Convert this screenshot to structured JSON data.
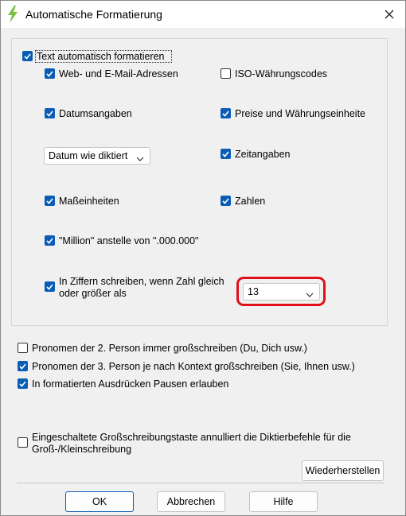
{
  "window": {
    "title": "Automatische Formatierung",
    "app_icon": "lightning-icon",
    "close_icon": "close-icon"
  },
  "main_checkbox": {
    "label": "Text automatisch formatieren",
    "checked": true
  },
  "options": {
    "web_email": {
      "label": "Web- und E-Mail-Adressen",
      "checked": true
    },
    "iso_currency": {
      "label": "ISO-Währungscodes",
      "checked": false
    },
    "dates": {
      "label": "Datumsangaben",
      "checked": true
    },
    "prices": {
      "label": "Preise und Währungseinheite",
      "checked": true
    },
    "date_format_select": {
      "value": "Datum wie diktiert"
    },
    "times": {
      "label": "Zeitangaben",
      "checked": true
    },
    "units": {
      "label": "Maßeinheiten",
      "checked": true
    },
    "numbers": {
      "label": "Zahlen",
      "checked": true
    },
    "million": {
      "label": "\"Million\" anstelle von \".000.000\"",
      "checked": true
    },
    "digits": {
      "line1": "In Ziffern schreiben, wenn Zahl gleich",
      "line2": "oder größer als",
      "checked": true
    },
    "digits_select": {
      "value": "13"
    }
  },
  "lower": {
    "pronoun2": {
      "label": "Pronomen der 2. Person immer großschreiben (Du, Dich usw.)",
      "checked": false
    },
    "pronoun3": {
      "label": "Pronomen der 3. Person je nach Kontext großschreiben (Sie, Ihnen usw.)",
      "checked": true
    },
    "pauses": {
      "label": "In formatierten Ausdrücken Pausen erlauben",
      "checked": true
    },
    "capslock": {
      "line1": "Eingeschaltete Großschreibungstaste annulliert die Diktierbefehle für die",
      "line2": "Groß-/Kleinschreibung",
      "checked": false
    }
  },
  "buttons": {
    "restore": "Wiederherstellen",
    "ok": "OK",
    "cancel": "Abbrechen",
    "help": "Hilfe"
  },
  "colors": {
    "accent": "#0a5cb4",
    "highlight": "#e0101a"
  }
}
